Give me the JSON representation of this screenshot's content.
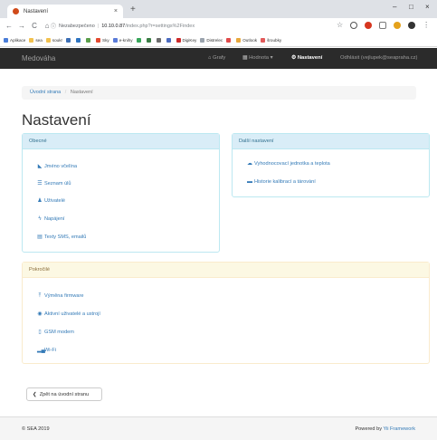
{
  "browser": {
    "tab_title": "Nastavení",
    "tab_close": "×",
    "new_tab": "+",
    "win_min": "–",
    "win_max": "□",
    "win_close": "×",
    "back": "←",
    "forward": "→",
    "reload": "C",
    "home": "⌂",
    "info": "ⓘ",
    "insecure_label": "Nezabezpečeno",
    "sep": "|",
    "host": "10.10.0.87",
    "path": "/index.php?r=settings%2Findex",
    "bookmarks": [
      {
        "label": "Aplikace",
        "color": "#4a7dd8"
      },
      {
        "label": "sea",
        "color": "#f2c14e"
      },
      {
        "label": "soukr",
        "color": "#f2c14e"
      },
      {
        "label": "",
        "color": "#3d6fb5"
      },
      {
        "label": "",
        "color": "#2f74c0"
      },
      {
        "label": "",
        "color": "#5a9e4a"
      },
      {
        "label": "Sky",
        "color": "#e2492f"
      },
      {
        "label": "e-knihy",
        "color": "#5a7bd8"
      },
      {
        "label": "",
        "color": "#38a65a"
      },
      {
        "label": "",
        "color": "#3a7d44"
      },
      {
        "label": "",
        "color": "#6b6b6b"
      },
      {
        "label": "",
        "color": "#4b6bbf"
      },
      {
        "label": "DigiKey",
        "color": "#cc2929"
      },
      {
        "label": "Distrelec",
        "color": "#9aa3ad"
      },
      {
        "label": "",
        "color": "#e04a4a"
      },
      {
        "label": "Outlook",
        "color": "#e8a83c"
      },
      {
        "label": "šroubky",
        "color": "#e25a5a"
      }
    ]
  },
  "navbar": {
    "brand": "Medováha",
    "links": [
      {
        "label": "Grafy",
        "icon": "home-icon"
      },
      {
        "label": "Hodnota ▾",
        "icon": "table-icon"
      },
      {
        "label": "Nastavení",
        "icon": "gear-icon",
        "active": true
      },
      {
        "label": "Odhlásit (vejlupek@seapraha.cz)",
        "icon": ""
      }
    ]
  },
  "breadcrumb": {
    "home": "Úvodní strana",
    "separator": "/",
    "current": "Nastavení"
  },
  "page_title": "Nastavení",
  "panels": {
    "general": {
      "title": "Obecné",
      "items": [
        {
          "label": "Jméno včelína",
          "icon": "tag-icon"
        },
        {
          "label": "Seznam úlů",
          "icon": "list-icon"
        },
        {
          "label": "Uživatelé",
          "icon": "user-icon"
        },
        {
          "label": "Napájení",
          "icon": "flash-icon"
        },
        {
          "label": "Texty SMS, emailů",
          "icon": "text-icon"
        }
      ]
    },
    "other": {
      "title": "Další nastavení",
      "items": [
        {
          "label": "Vyhodnocovací jednotka a teplota",
          "icon": "cloud-icon"
        },
        {
          "label": "Historie kalibrací a tárování",
          "icon": "book-icon"
        }
      ]
    },
    "advanced": {
      "title": "Pokročilé",
      "items": [
        {
          "label": "Výměna firmware",
          "icon": "upload-icon"
        },
        {
          "label": "Aktivní uživatelé a ustrojí",
          "icon": "eye-icon"
        },
        {
          "label": "GSM modem",
          "icon": "phone-icon"
        },
        {
          "label": "Wi-Fi",
          "icon": "signal-icon"
        }
      ]
    }
  },
  "back_button": "Zpět na úvodní stranu",
  "footer": {
    "left": "© SEA 2019",
    "right_prefix": "Powered by",
    "right_link": "Yii Framework"
  },
  "colors": {
    "navbar_bg": "#2b2b2b",
    "link": "#337ab7",
    "info_heading_bg": "#d9edf7",
    "warning_heading_bg": "#fcf8e3"
  }
}
